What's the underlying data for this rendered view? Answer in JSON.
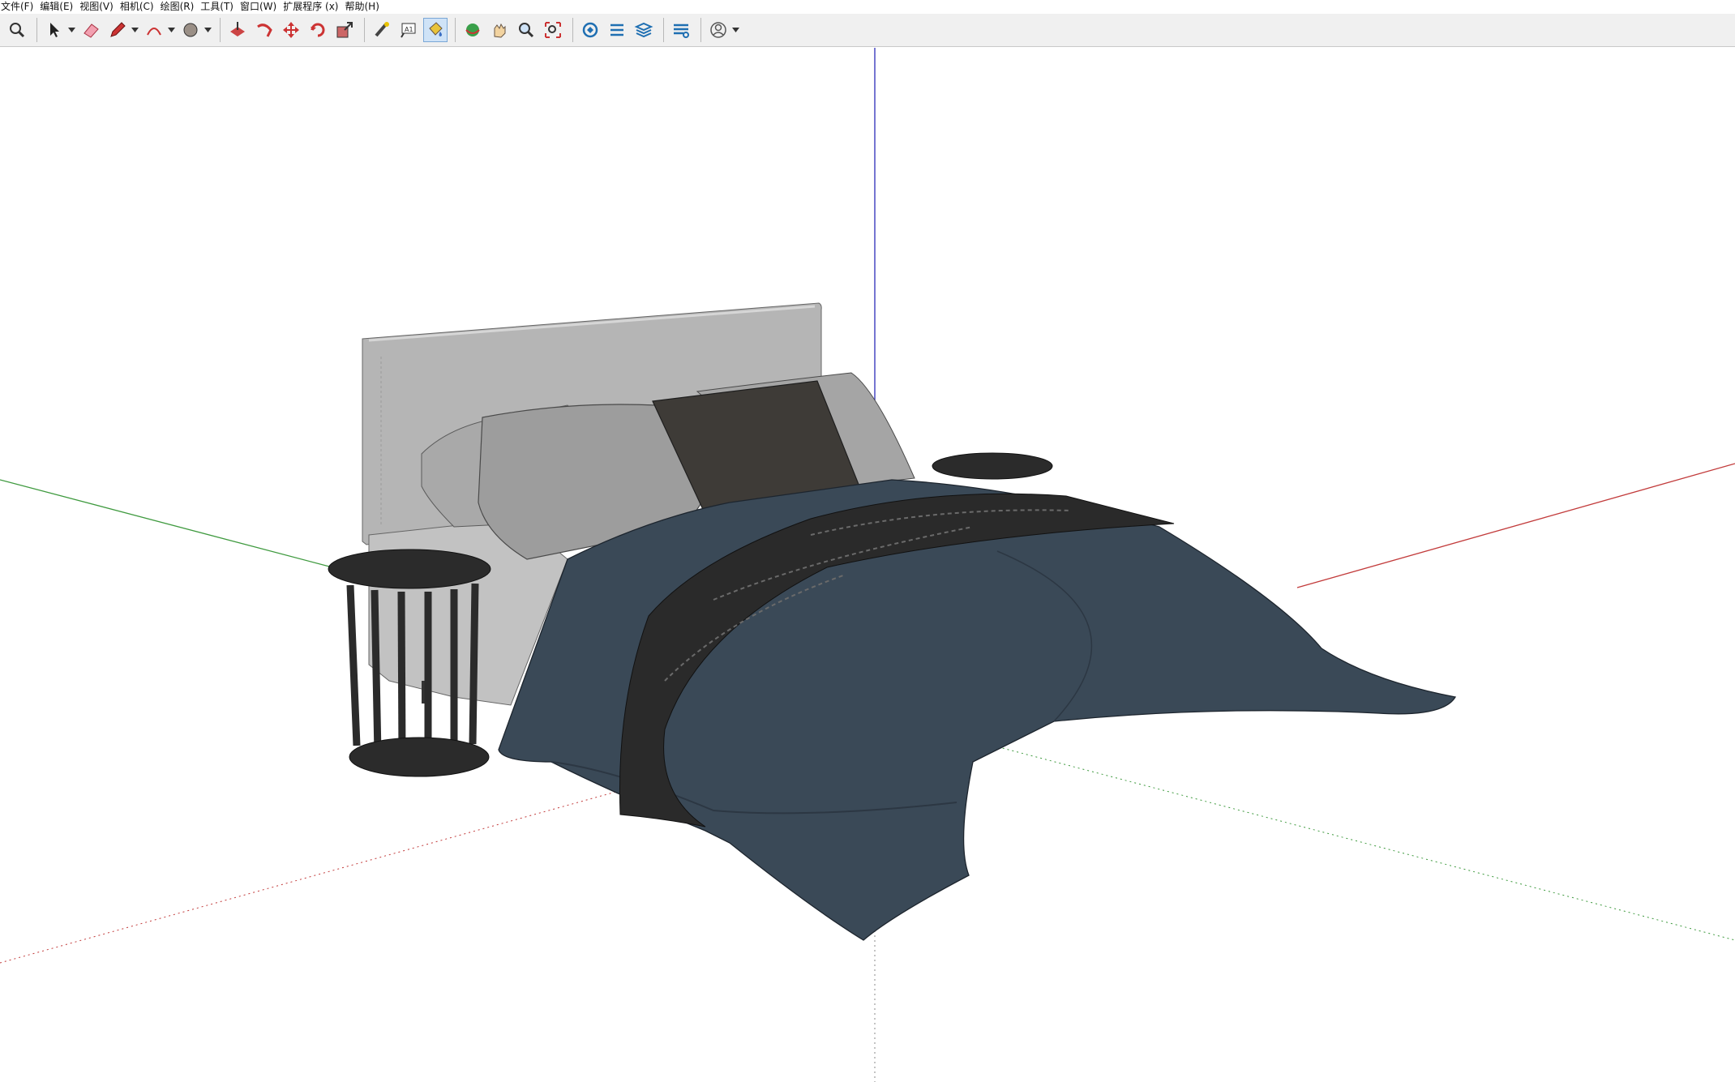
{
  "menu": [
    "文件(F)",
    "编辑(E)",
    "视图(V)",
    "相机(C)",
    "绘图(R)",
    "工具(T)",
    "窗口(W)",
    "扩展程序 (x)",
    "帮助(H)"
  ],
  "toolbar": {
    "groups": [
      [
        "zoom-icon"
      ],
      [
        "select-icon",
        "eraser-icon",
        "pencil-icon",
        "arc-icon",
        "circle-icon"
      ],
      [
        "pushpull-icon",
        "followme-icon",
        "move-icon",
        "rotate-icon",
        "scale-icon"
      ],
      [
        "tape-measure-icon",
        "text-icon",
        "paint-bucket-icon"
      ],
      [
        "orbit-icon",
        "pan-icon",
        "zoom-tool-icon",
        "zoom-extents-icon"
      ],
      [
        "warehouse-icon",
        "extension-icon",
        "layers-icon"
      ],
      [
        "sandbox-icon"
      ],
      [
        "account-icon"
      ]
    ],
    "active": "paint-bucket-icon"
  },
  "scene": {
    "axis_colors": {
      "red": "#c23b3b",
      "green": "#3f9a3f",
      "blue": "#2b2bb8"
    },
    "materials": {
      "headboard": "#b5b5b5",
      "pillow_light": "#a8a8a8",
      "pillow_dark": "#3e3b37",
      "duvet": "#3a4957",
      "throw": "#2a2a2a",
      "side_table": "#2b2b2b"
    }
  }
}
